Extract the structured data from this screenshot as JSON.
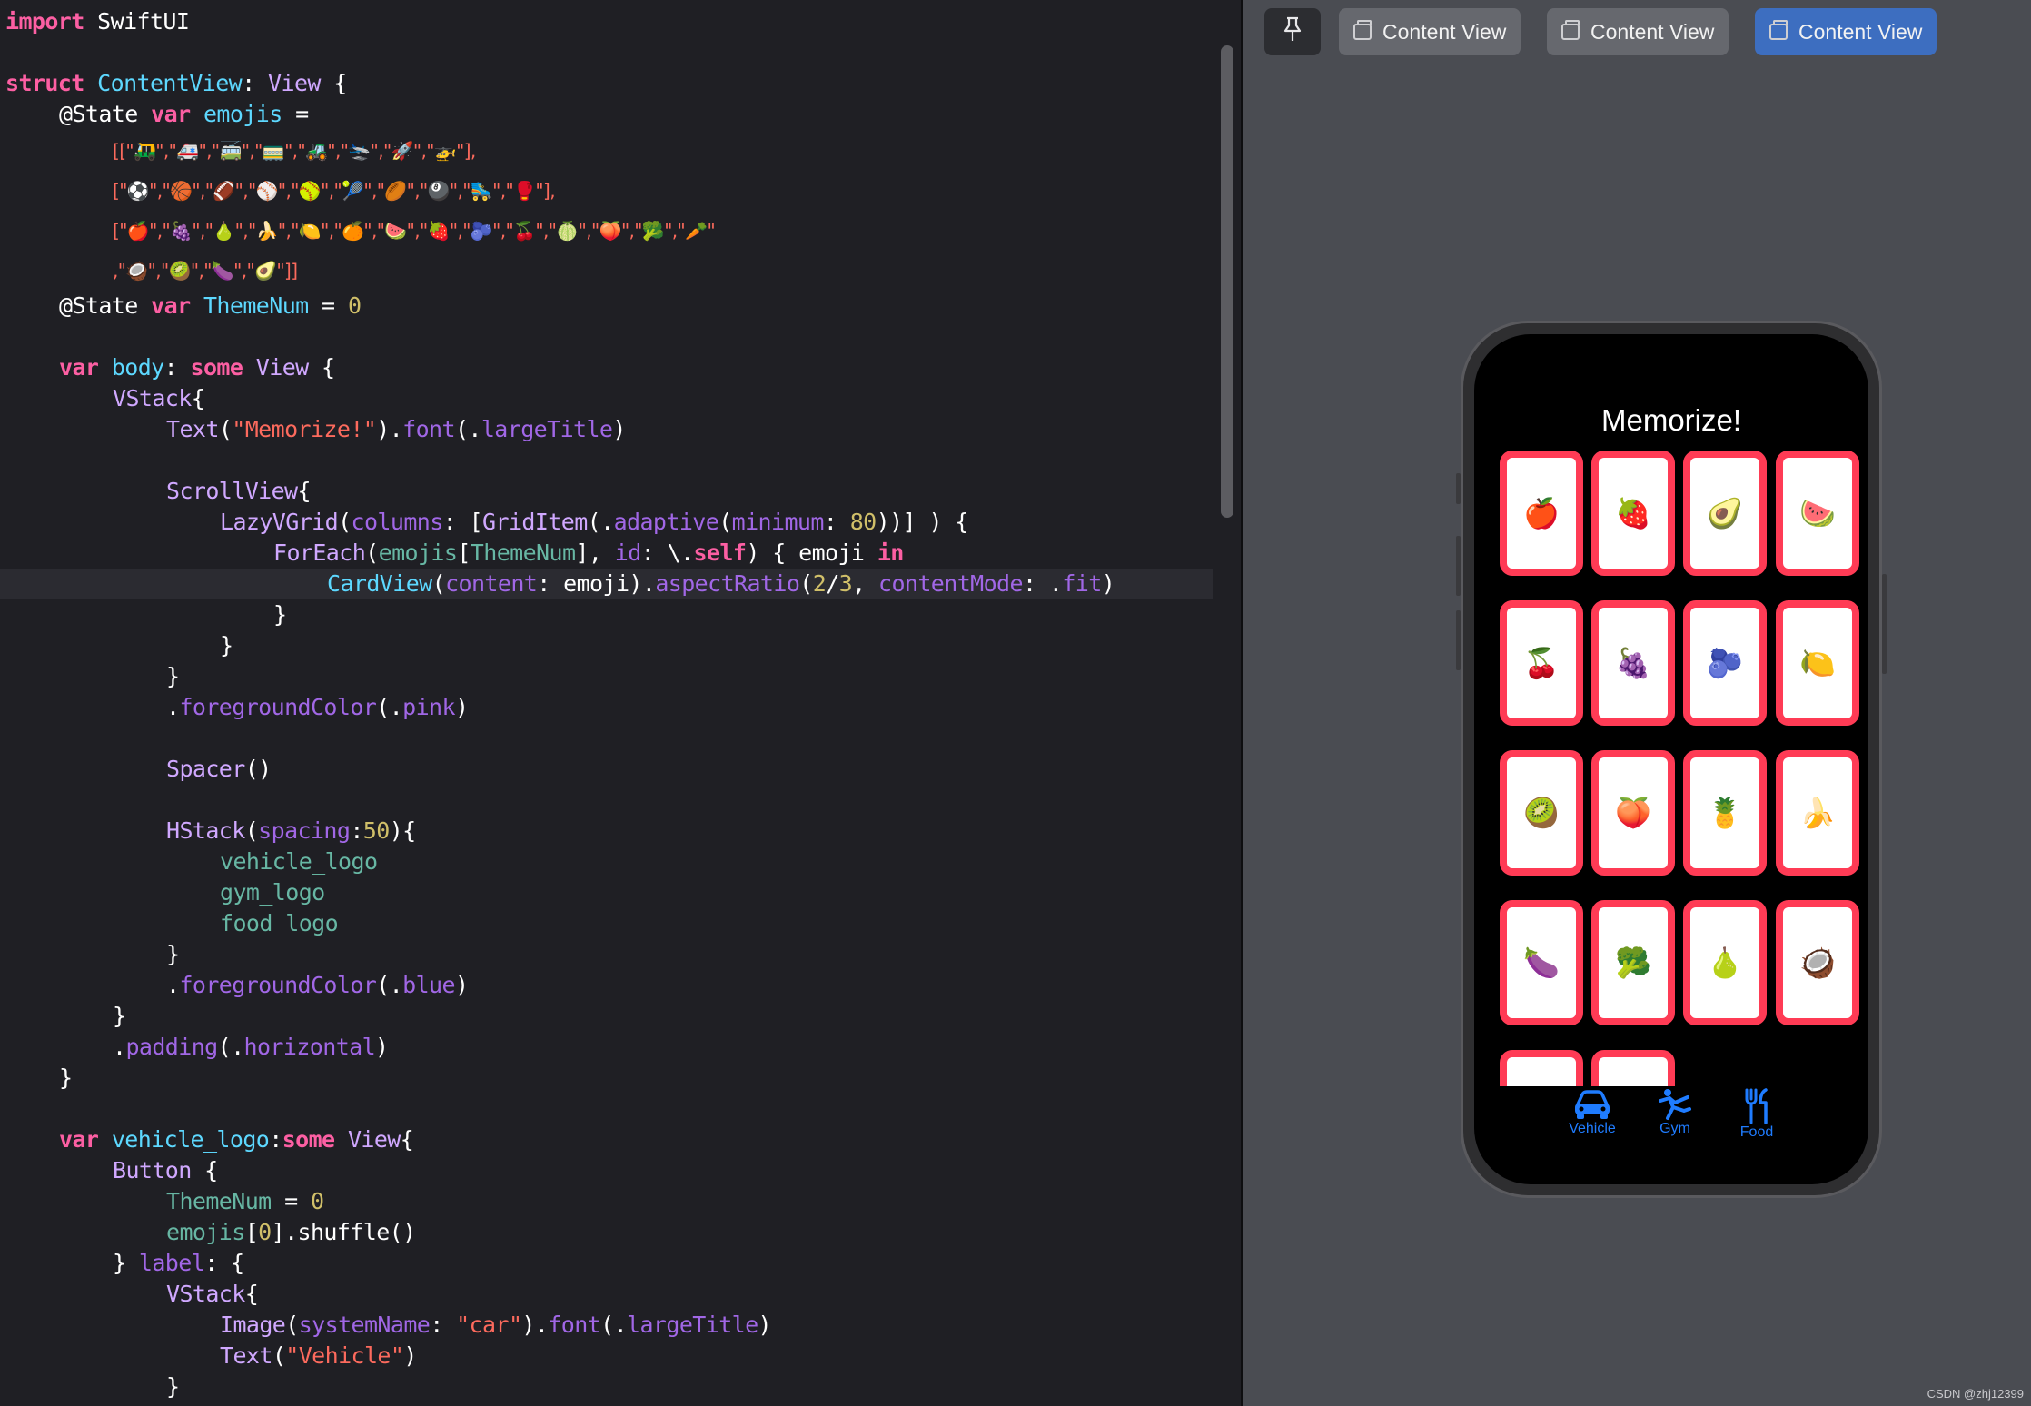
{
  "code": {
    "l01": [
      "import",
      " SwiftUI"
    ],
    "l03": [
      "struct",
      " ",
      "ContentView",
      ": ",
      "View",
      " {"
    ],
    "l04": [
      "@State",
      " ",
      "var",
      " ",
      "emojis",
      " ="
    ],
    "l05": [
      "[[\"🛺\",\"🚑\",\"🚎\",\"🚃\",\"🚜\",\"🛬\",\"🚀\",\"🚁\"],"
    ],
    "l06": [
      "[\"⚽\",\"🏀\",\"🏈\",\"⚾\",\"🥎\",\"🎾\",\"🏉\",\"🎱\",\"🛼\",\"🥊\"],"
    ],
    "l07": [
      "[\"🍎\",\"🍇\",\"🍐\",\"🍌\",\"🍋\",\"🍊\",\"🍉\",\"🍓\",\"🫐\",\"🍒\",\"🍈\",\"🍑\",\"🥦\",\"🥕\""
    ],
    "l08": [
      ",\"🥥\",\"🥝\",\"🍆\",\"🥑\"]]"
    ],
    "l09": [
      "@State",
      " ",
      "var",
      " ",
      "ThemeNum",
      " = ",
      "0"
    ],
    "l11": [
      "var",
      " ",
      "body",
      ": ",
      "some",
      " ",
      "View",
      " {"
    ],
    "l12": [
      "VStack",
      "{"
    ],
    "l13": [
      "Text",
      "(",
      "\"Memorize!\"",
      ").",
      "font",
      "(.",
      "largeTitle",
      ")"
    ],
    "l15": [
      "ScrollView",
      "{"
    ],
    "l16": [
      "LazyVGrid",
      "(",
      "columns",
      ": [",
      "GridItem",
      "(.",
      "adaptive",
      "(",
      "minimum",
      ": ",
      "80",
      "))] ) {"
    ],
    "l17": [
      "ForEach",
      "(",
      "emojis",
      "[",
      "ThemeNum",
      "], ",
      "id",
      ": \\.",
      "self",
      ") { emoji ",
      "in"
    ],
    "l18": [
      "CardView",
      "(",
      "content",
      ": emoji).",
      "aspectRatio",
      "(",
      "2",
      "/",
      "3",
      ", ",
      "contentMode",
      ": .",
      "fit",
      ")"
    ],
    "l19": [
      "}"
    ],
    "l20": [
      "}"
    ],
    "l21": [
      "}"
    ],
    "l22": [
      ".",
      "foregroundColor",
      "(.",
      "pink",
      ")"
    ],
    "l24": [
      "Spacer",
      "()"
    ],
    "l26": [
      "HStack",
      "(",
      "spacing",
      ":",
      "50",
      "){"
    ],
    "l27": [
      "vehicle_logo"
    ],
    "l28": [
      "gym_logo"
    ],
    "l29": [
      "food_logo"
    ],
    "l30": [
      "}"
    ],
    "l31": [
      ".",
      "foregroundColor",
      "(.",
      "blue",
      ")"
    ],
    "l32": [
      "}"
    ],
    "l33": [
      ".",
      "padding",
      "(.",
      "horizontal",
      ")"
    ],
    "l34": [
      "}"
    ],
    "l36": [
      "var",
      " ",
      "vehicle_logo",
      ":",
      "some",
      " ",
      "View",
      "{"
    ],
    "l37": [
      "Button",
      " {"
    ],
    "l38": [
      "ThemeNum",
      " = ",
      "0"
    ],
    "l39": [
      "emojis",
      "[",
      "0",
      "].shuffle()"
    ],
    "l40": [
      "} ",
      "label",
      ": {"
    ],
    "l41": [
      "VStack",
      "{"
    ],
    "l42": [
      "Image",
      "(",
      "systemName",
      ": ",
      "\"car\"",
      ").",
      "font",
      "(.",
      "largeTitle",
      ")"
    ],
    "l43": [
      "Text",
      "(",
      "\"Vehicle\"",
      ")"
    ],
    "l44": [
      "}"
    ]
  },
  "preview_toolbar": {
    "pin_icon": "pin-icon",
    "tabs": [
      "Content View",
      "Content View",
      "Content View"
    ],
    "active_tab_index": 2
  },
  "app": {
    "title": "Memorize!",
    "cards": [
      "🍎",
      "🍓",
      "🥑",
      "🍉",
      "🍒",
      "🍇",
      "🫐",
      "🍋",
      "🥝",
      "🍑",
      "🍍",
      "🍌",
      "🍆",
      "🥦",
      "🍐",
      "🥥",
      "",
      ""
    ],
    "card_color": "#ff3b55",
    "tabs": [
      {
        "label": "Vehicle",
        "icon": "car-icon"
      },
      {
        "label": "Gym",
        "icon": "figure-kickboxing-icon"
      },
      {
        "label": "Food",
        "icon": "fork-knife-icon"
      }
    ],
    "tab_color": "#1f7cff"
  },
  "watermark": "CSDN @zhj12399"
}
